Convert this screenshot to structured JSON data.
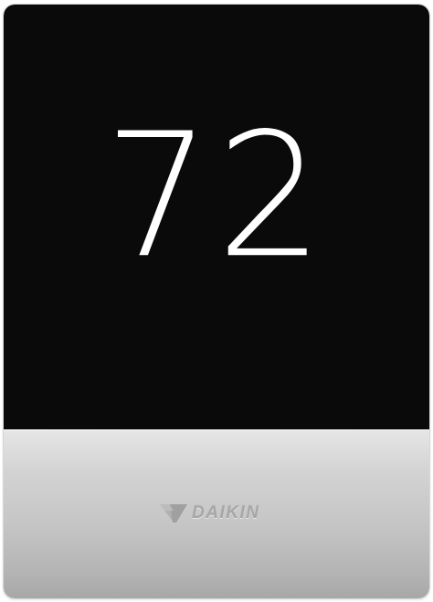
{
  "screen": {
    "temperature": "72"
  },
  "bezel": {
    "brand": "DAIKIN"
  },
  "colors": {
    "screen_bg": "#0a0a0a",
    "temp_text": "#ffffff",
    "bezel_top": "#e6e6e6",
    "bezel_bottom": "#a7a7a7",
    "logo": "#a7a7a7"
  },
  "icons": {
    "logo_mark": "daikin-logo-mark-icon"
  }
}
